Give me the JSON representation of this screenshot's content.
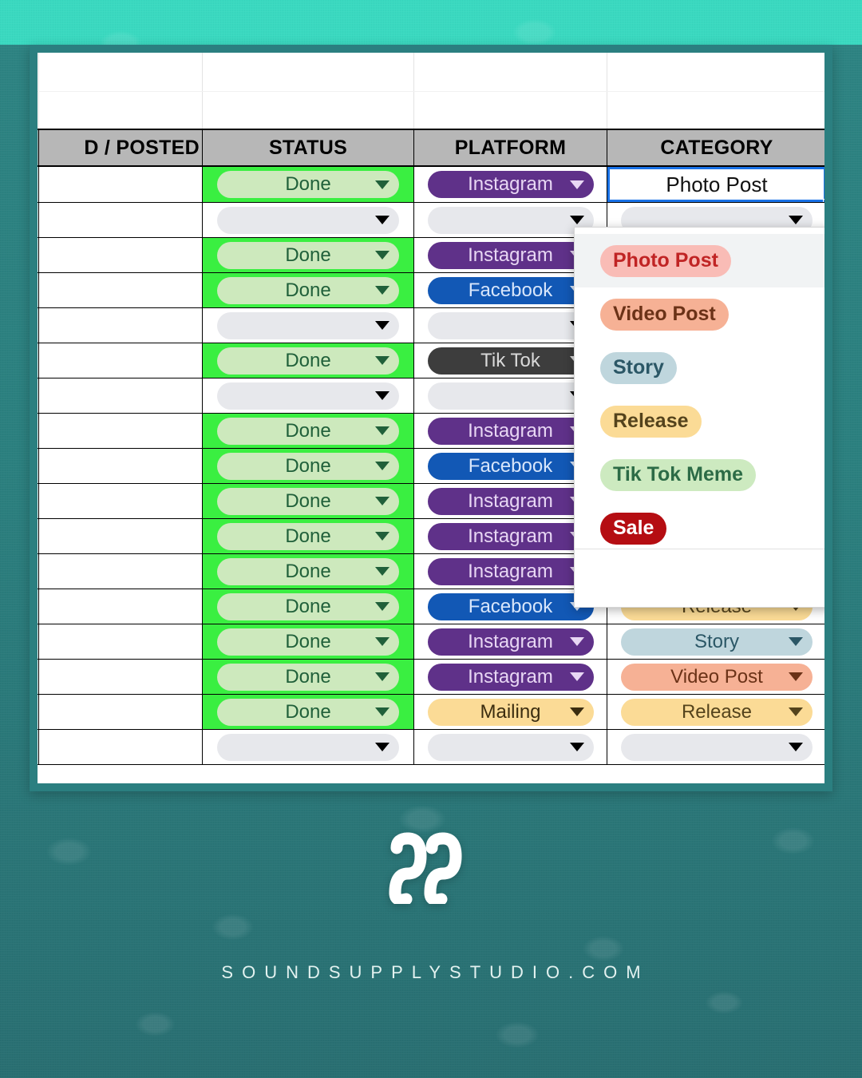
{
  "brand": {
    "logo_icon": "double-s-wave-logo",
    "site_url": "SOUNDSUPPLYSTUDIO.COM",
    "accent_turquoise": "#3ad9c0",
    "accent_teal": "#2b7f80"
  },
  "spreadsheet": {
    "headers": {
      "checkbox": "",
      "posted": "D / POSTED",
      "status": "STATUS",
      "platform": "PLATFORM",
      "category": "CATEGORY",
      "extra": ""
    },
    "rows": [
      {
        "check": "✔",
        "status": "Done",
        "platform": "Instagram",
        "category": "Photo Post",
        "selected": true
      },
      {
        "check": "☐",
        "status": "",
        "platform": "",
        "category": ""
      },
      {
        "check": "✔",
        "status": "Done",
        "platform": "Instagram",
        "category": ""
      },
      {
        "check": "✔",
        "status": "Done",
        "platform": "Facebook",
        "category": ""
      },
      {
        "check": "☐",
        "status": "",
        "platform": "",
        "category": ""
      },
      {
        "check": "✔",
        "status": "Done",
        "platform": "Tik Tok",
        "category": ""
      },
      {
        "check": "☐",
        "status": "",
        "platform": "",
        "category": ""
      },
      {
        "check": "✔",
        "status": "Done",
        "platform": "Instagram",
        "category": ""
      },
      {
        "check": "✔",
        "status": "Done",
        "platform": "Facebook",
        "category": ""
      },
      {
        "check": "✔",
        "status": "Done",
        "platform": "Instagram",
        "category": ""
      },
      {
        "check": "✔",
        "status": "Done",
        "platform": "Instagram",
        "category": ""
      },
      {
        "check": "✔",
        "status": "Done",
        "platform": "Instagram",
        "category": ""
      },
      {
        "check": "✔",
        "status": "Done",
        "platform": "Facebook",
        "category": "Release"
      },
      {
        "check": "✔",
        "status": "Done",
        "platform": "Instagram",
        "category": "Story"
      },
      {
        "check": "✔",
        "status": "Done",
        "platform": "Instagram",
        "category": "Video Post"
      },
      {
        "check": "✔",
        "status": "Done",
        "platform": "Mailing",
        "category": "Release"
      },
      {
        "check": "☐",
        "status": "",
        "platform": "",
        "category": ""
      }
    ]
  },
  "category_dropdown": {
    "selected_value": "Photo Post",
    "options": [
      {
        "label": "Photo Post",
        "color_class": "photopost",
        "highlighted": true
      },
      {
        "label": "Video Post",
        "color_class": "videopost",
        "highlighted": false
      },
      {
        "label": "Story",
        "color_class": "story",
        "highlighted": false
      },
      {
        "label": "Release",
        "color_class": "release",
        "highlighted": false
      },
      {
        "label": "Tik Tok Meme",
        "color_class": "tiktokmeme",
        "highlighted": false
      },
      {
        "label": "Sale",
        "color_class": "salechip",
        "highlighted": false
      }
    ]
  }
}
